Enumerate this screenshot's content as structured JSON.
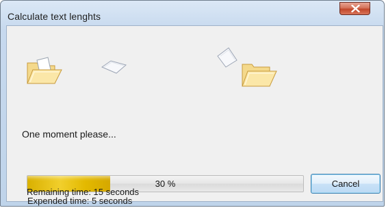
{
  "window": {
    "title": "Calculate text lenghts"
  },
  "status": {
    "message": "One moment please..."
  },
  "progress": {
    "percent": 30,
    "label": "30 %"
  },
  "buttons": {
    "cancel_label": "Cancel"
  },
  "times": {
    "expended": "Expended time: 5 seconds",
    "remaining": "Remaining time: 15 seconds"
  },
  "icons": {
    "close": "close-icon",
    "source_folder": "open-folder-icon",
    "flying_paper": "paper-sheet-icon",
    "destination_folder": "open-folder-icon"
  },
  "colors": {
    "progress_fill": "#e3b900",
    "close_button": "#c2472b",
    "title_bar": "#c7d9ee"
  }
}
